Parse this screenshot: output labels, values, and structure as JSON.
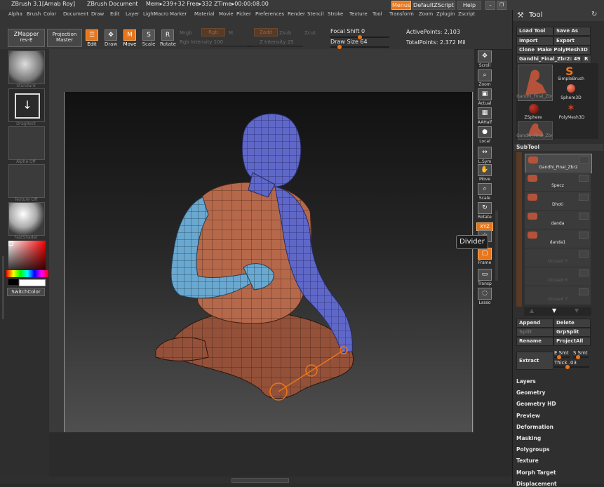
{
  "titlebar": {
    "app": "ZBrush  3.1[Arnab Roy]",
    "document": "ZBrush Document",
    "mem": "Mem▸239+32 Free▸332 ZTime▸00:00:08.00",
    "menus_label": "Menus",
    "script_label": "DefaultZScript",
    "help_label": "Help"
  },
  "menubar": [
    "Alpha",
    "Brush",
    "Color",
    "Document",
    "Draw",
    "Edit",
    "Layer",
    "Light",
    "Macro",
    "Marker",
    "Material",
    "Movie",
    "Picker",
    "Preferences",
    "Render",
    "Stencil",
    "Stroke",
    "Texture",
    "Tool",
    "Transform",
    "Zoom",
    "Zplugin",
    "Zscript"
  ],
  "toolbar": {
    "zmapper": "ZMapper",
    "zmapper_sub": "rev-E",
    "projection": "Projection",
    "projection_sub": "Master",
    "tools": [
      {
        "glyph": "☰",
        "label": "Edit",
        "active": true
      },
      {
        "glyph": "✥",
        "label": "Draw",
        "active": false
      },
      {
        "glyph": "M",
        "label": "Move",
        "active": true
      },
      {
        "glyph": "S",
        "label": "Scale",
        "active": false
      },
      {
        "glyph": "R",
        "label": "Rotate",
        "active": false
      }
    ],
    "mrgb": "Mrgb",
    "rgb_label": "Rgb",
    "m_label": "M",
    "rgb_intensity": "Rgb Intensity 100",
    "zadd": "Zadd",
    "zsub": "Zsub",
    "zcut": "Zcut",
    "z_intensity": "Z Intensity 25",
    "focal_shift": "Focal Shift 0",
    "focal_shift_value": 0,
    "draw_size": "Draw Size 64",
    "draw_size_value": 64,
    "active_points": "ActivePoints: 2,103",
    "total_points": "TotalPoints: 2.372 Mil"
  },
  "leftshelf": [
    {
      "name": "Standard",
      "kind": "brush"
    },
    {
      "name": "DragRect",
      "kind": "stroke"
    },
    {
      "name": "Alpha Off",
      "kind": "alpha"
    },
    {
      "name": "Texture Off",
      "kind": "texture"
    },
    {
      "name": "FastShader",
      "kind": "material"
    }
  ],
  "switch_color": "SwitchColor",
  "rightshelf": [
    {
      "label": "Scroll",
      "glyph": "✥",
      "active": false
    },
    {
      "label": "Zoom",
      "glyph": "⌕",
      "active": false
    },
    {
      "label": "Actual",
      "glyph": "▣",
      "active": false
    },
    {
      "label": "AAHalf",
      "glyph": "▦",
      "active": false
    },
    {
      "label": "Local",
      "glyph": "●",
      "active": false
    },
    {
      "label": "L.Sym",
      "glyph": "↔",
      "active": false
    },
    {
      "label": "Move",
      "glyph": "✋",
      "active": false
    },
    {
      "label": "Scale",
      "glyph": "⌕",
      "active": false
    },
    {
      "label": "Rotate",
      "glyph": "↻",
      "active": false
    },
    {
      "label": "XYZ",
      "glyph": "",
      "active": true
    },
    {
      "label": "",
      "glyph": "☆",
      "active": false
    },
    {
      "label": "Frame",
      "glyph": "▢",
      "active": true
    },
    {
      "label": "Transp",
      "glyph": "▭",
      "active": false
    },
    {
      "label": "Lasso",
      "glyph": "◌",
      "active": false
    }
  ],
  "tooltip": "Divider",
  "palette": {
    "title": "Tool",
    "load_tool": "Load Tool",
    "save_as": "Save As",
    "import": "Import",
    "export": "Export",
    "clone": "Clone",
    "make_polymesh": "Make PolyMesh3D",
    "current_tool": "Gandhi_Final_Zbr2: 49",
    "r_label": "R",
    "tool_slots": [
      {
        "label": "Gandhi_Final_Zbr"
      },
      {
        "label": "SimpleBrush"
      },
      {
        "label": "Sphere3D"
      },
      {
        "label": "ZSphere"
      },
      {
        "label": "PolyMesh3D"
      },
      {
        "label": "Gandhi_Final_Zbr"
      }
    ],
    "subtool_title": "SubTool",
    "subtools": [
      {
        "name": "Gandhi_Final_Zbr2",
        "visible": true
      },
      {
        "name": "Specz",
        "visible": true
      },
      {
        "name": "Dhoti",
        "visible": true
      },
      {
        "name": "danda",
        "visible": true
      },
      {
        "name": "danda1",
        "visible": true
      },
      {
        "name": "Unused 5",
        "visible": false
      },
      {
        "name": "Unused 6",
        "visible": false
      },
      {
        "name": "Unused 7",
        "visible": false
      }
    ],
    "append": "Append",
    "delete": "Delete",
    "split": "Split",
    "grpsplit": "GrpSplit",
    "rename": "Rename",
    "projectall": "ProjectAll",
    "extract": "Extract",
    "e_smt": "E Smt",
    "s_smt": "S Smt",
    "thick": "Thick .03",
    "sections": [
      "Layers",
      "Geometry",
      "Geometry HD",
      "Preview",
      "Deformation",
      "Masking",
      "Polygroups",
      "Texture",
      "Morph Target",
      "Displacement"
    ]
  },
  "colors": {
    "accent": "#e8761a",
    "torso": "#b5684a",
    "head": "#5f68c8",
    "arm": "#6aa8d0",
    "panel": "#2f2f2f"
  }
}
